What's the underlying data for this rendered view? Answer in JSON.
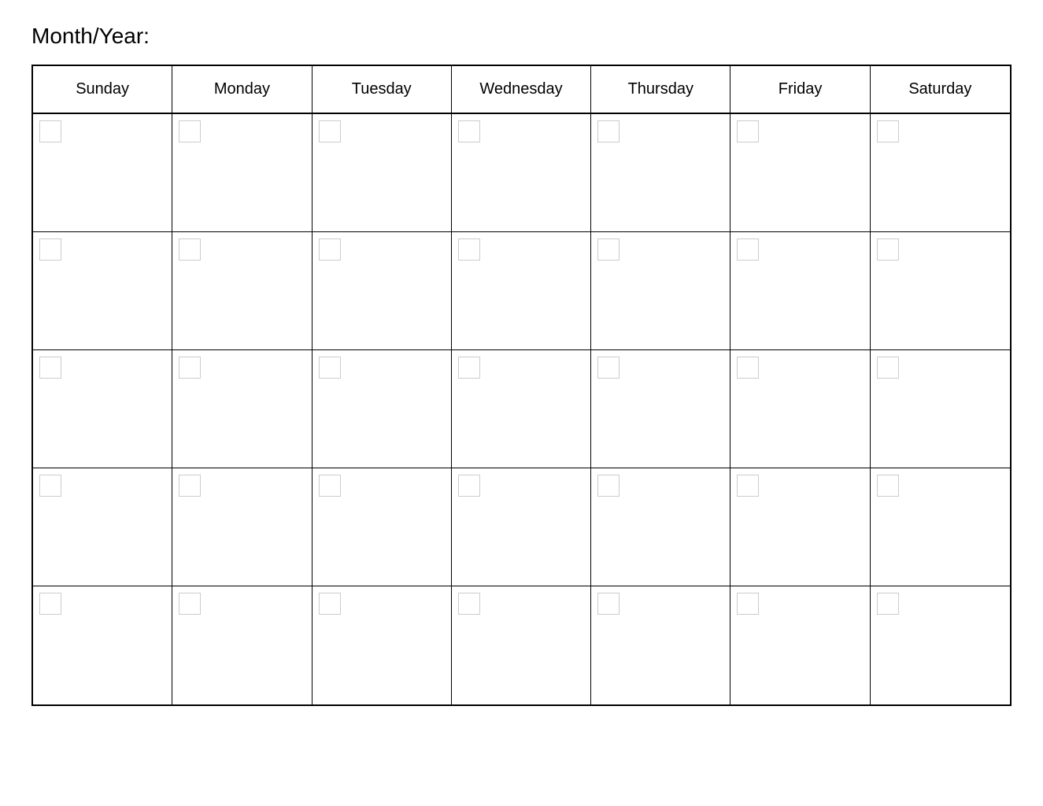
{
  "header": {
    "title": "Month/Year:"
  },
  "calendar": {
    "days": [
      "Sunday",
      "Monday",
      "Tuesday",
      "Wednesday",
      "Thursday",
      "Friday",
      "Saturday"
    ],
    "rows": 5
  }
}
